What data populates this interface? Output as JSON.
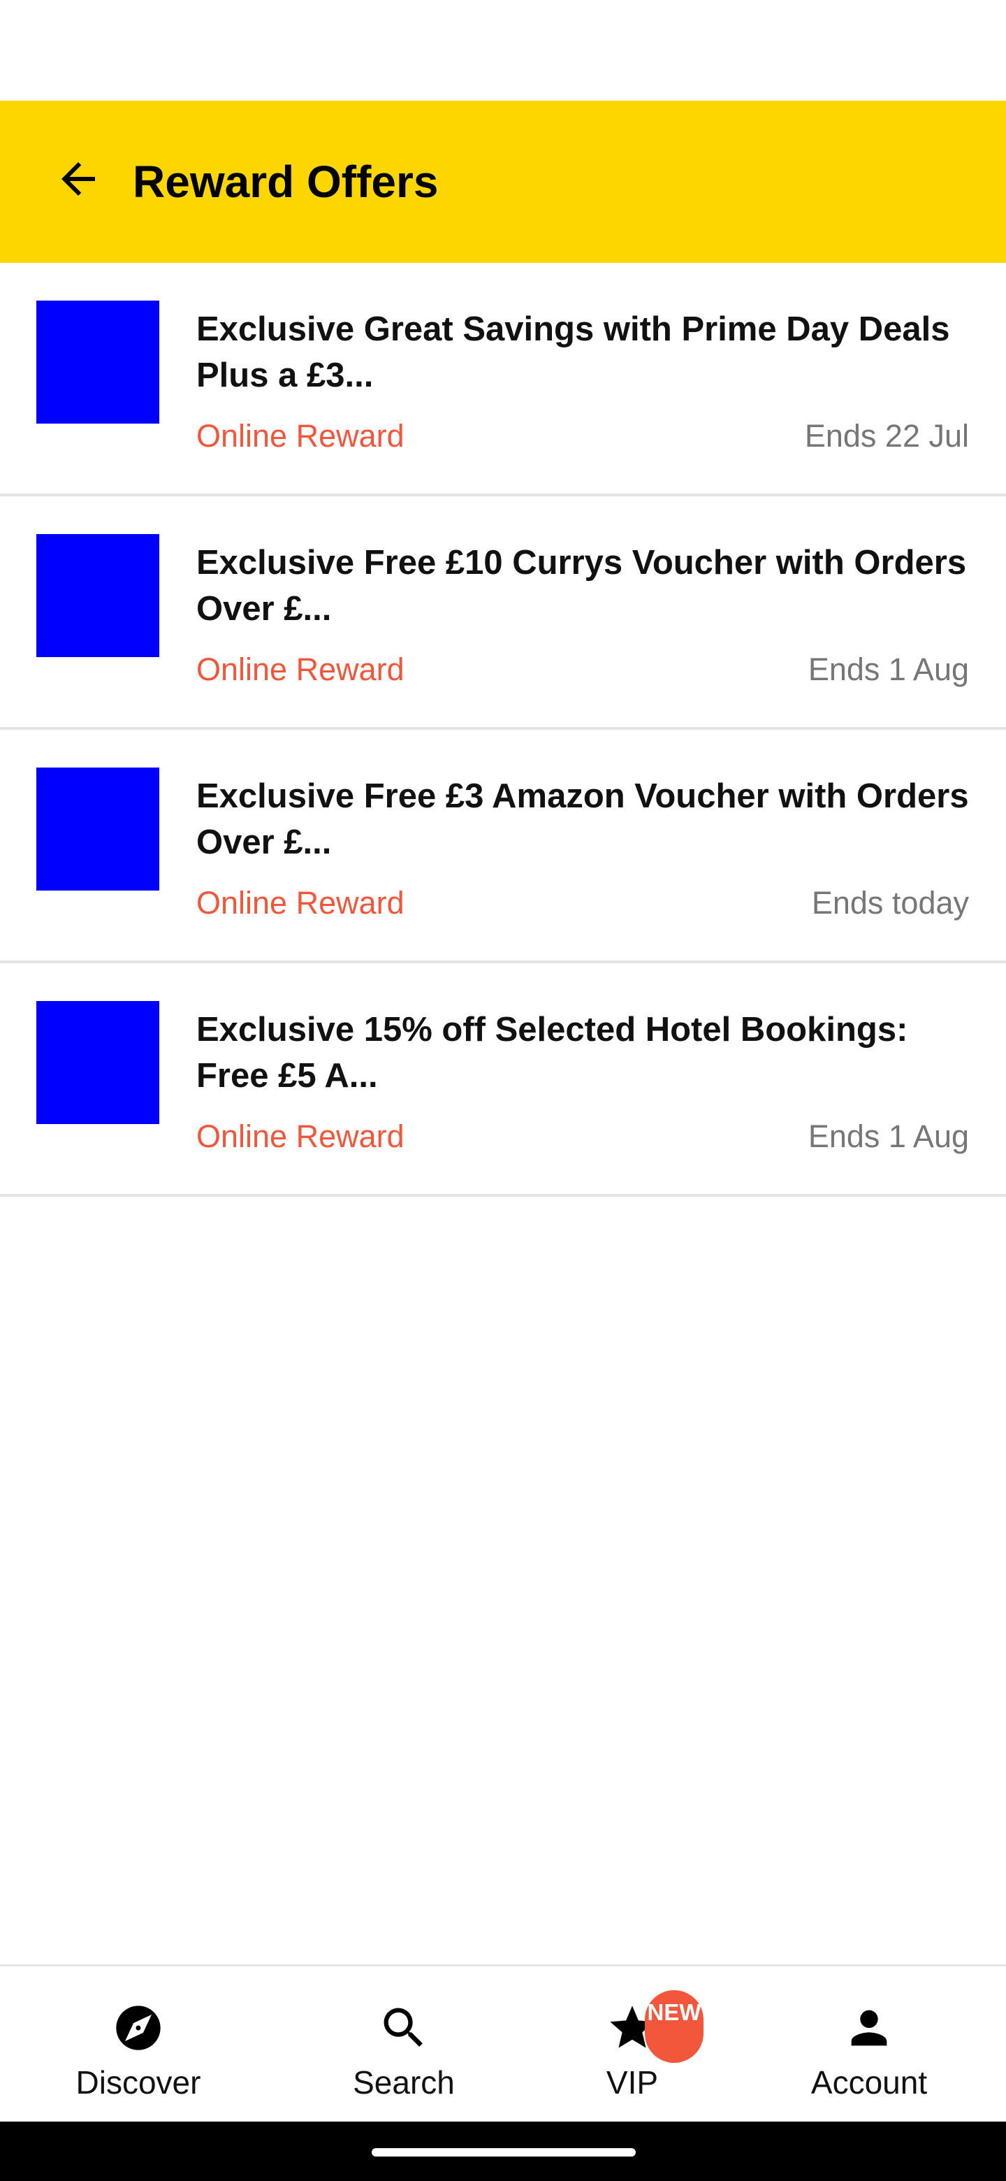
{
  "app_bar": {
    "title": "Reward Offers",
    "background_color": "#FDD600",
    "back_icon": "arrow-left-icon"
  },
  "offers": [
    {
      "title": "Exclusive Great Savings with Prime Day Deals Plus a £3...",
      "type": "Online Reward",
      "ends": "Ends 22 Jul"
    },
    {
      "title": "Exclusive Free £10 Currys Voucher with Orders Over £...",
      "type": "Online Reward",
      "ends": "Ends 1 Aug"
    },
    {
      "title": "Exclusive Free £3 Amazon Voucher with Orders Over £...",
      "type": "Online Reward",
      "ends": "Ends today"
    },
    {
      "title": "Exclusive 15% off Selected Hotel Bookings: Free £5 A...",
      "type": "Online Reward",
      "ends": "Ends 1 Aug"
    }
  ],
  "bottom_nav": {
    "items": [
      {
        "label": "Discover",
        "icon": "compass-icon"
      },
      {
        "label": "Search",
        "icon": "search-icon"
      },
      {
        "label": "VIP",
        "icon": "star-icon",
        "badge": "NEW"
      },
      {
        "label": "Account",
        "icon": "person-icon"
      }
    ]
  },
  "colors": {
    "accent": "#FDD600",
    "reward_type": "#F2573B",
    "thumbnail": "#0000FF",
    "muted_text": "#767676"
  }
}
